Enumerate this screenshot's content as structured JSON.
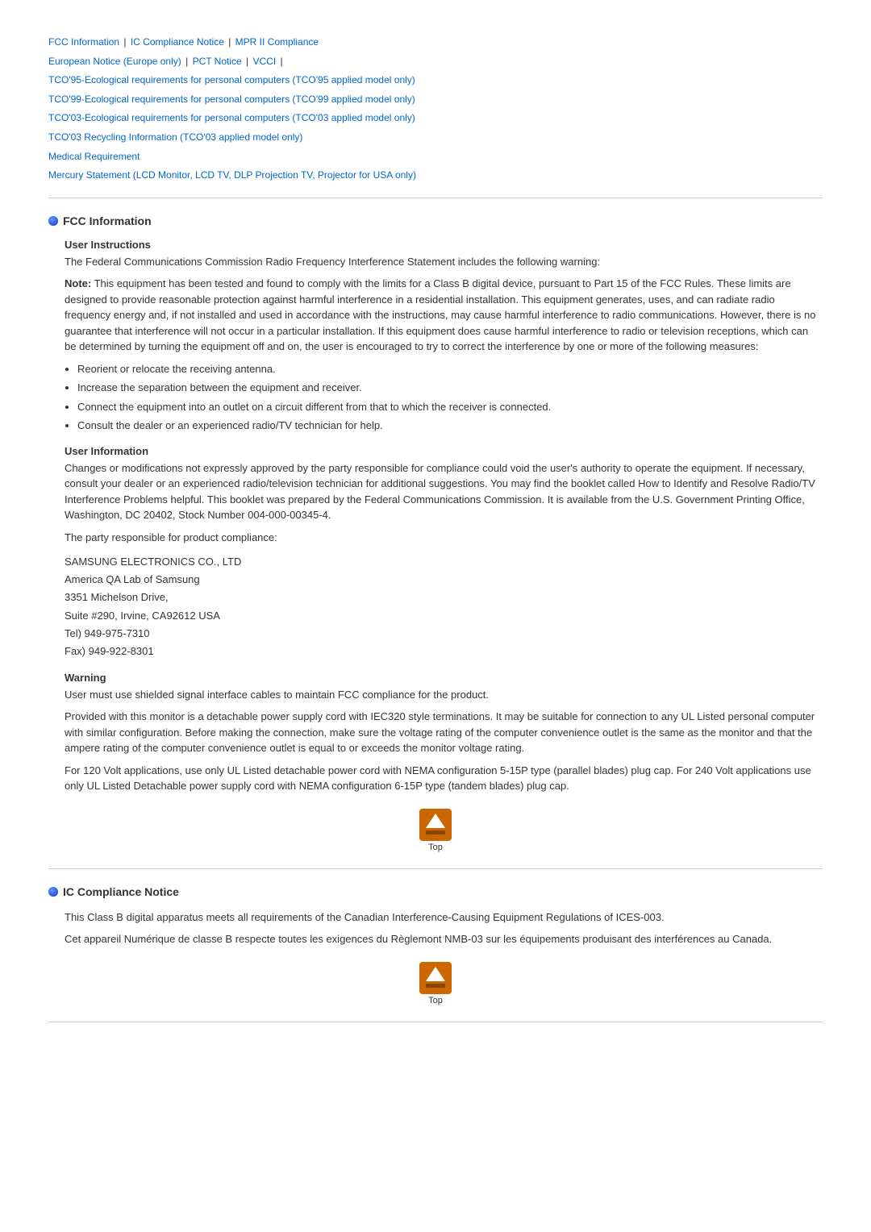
{
  "nav": {
    "links": [
      {
        "label": "FCC Information",
        "id": "fcc"
      },
      {
        "label": "IC Compliance Notice",
        "id": "ic"
      },
      {
        "label": "MPR II Compliance",
        "id": "mpr"
      },
      {
        "label": "European Notice (Europe only)",
        "id": "eu"
      },
      {
        "label": "PCT Notice",
        "id": "pct"
      },
      {
        "label": "VCCI",
        "id": "vcci"
      },
      {
        "label": "TCO'95-Ecological requirements for personal computers (TCO'95 applied model only)",
        "id": "tco95"
      },
      {
        "label": "TCO'99-Ecological requirements for personal computers (TCO'99 applied model only)",
        "id": "tco99"
      },
      {
        "label": "TCO'03-Ecological requirements for personal computers (TCO'03 applied model only)",
        "id": "tco03"
      },
      {
        "label": "TCO'03 Recycling Information (TCO'03 applied model only)",
        "id": "tco03r"
      },
      {
        "label": "Medical Requirement",
        "id": "medical"
      },
      {
        "label": "Mercury Statement (LCD Monitor, LCD TV, DLP Projection TV, Projector for USA only)",
        "id": "mercury"
      }
    ]
  },
  "sections": {
    "fcc": {
      "title": "FCC Information",
      "user_instructions_title": "User Instructions",
      "user_instructions_intro": "The Federal Communications Commission Radio Frequency Interference Statement includes the following warning:",
      "note_bold": "Note:",
      "note_text": " This equipment has been tested and found to comply with the limits for a Class B digital device, pursuant to Part 15 of the FCC Rules. These limits are designed to provide reasonable protection against harmful interference in a residential installation. This equipment generates, uses, and can radiate radio frequency energy and, if not installed and used in accordance with the instructions, may cause harmful interference to radio communications. However, there is no guarantee that interference will not occur in a particular installation. If this equipment does cause harmful interference to radio or television receptions, which can be determined by turning the equipment off and on, the user is encouraged to try to correct the interference by one or more of the following measures:",
      "measures": [
        "Reorient or relocate the receiving antenna.",
        "Increase the separation between the equipment and receiver.",
        "Connect the equipment into an outlet on a circuit different from that to which the receiver is connected.",
        "Consult the dealer or an experienced radio/TV technician for help."
      ],
      "user_information_title": "User Information",
      "user_information_text": "Changes or modifications not expressly approved by the party responsible for compliance could void the user's authority to operate the equipment. If necessary, consult your dealer or an experienced radio/television technician for additional suggestions. You may find the booklet called How to Identify and Resolve Radio/TV Interference Problems helpful. This booklet was prepared by the Federal Communications Commission. It is available from the U.S. Government Printing Office, Washington, DC 20402, Stock Number 004-000-00345-4.",
      "party_text": "The party responsible for product compliance:",
      "company_name": "SAMSUNG ELECTRONICS CO., LTD",
      "address_line1": "America QA Lab of Samsung",
      "address_line2": "3351 Michelson Drive,",
      "address_line3": "Suite #290, Irvine, CA92612 USA",
      "tel": "Tel) 949-975-7310",
      "fax": "Fax) 949-922-8301",
      "warning_title": "Warning",
      "warning_text": "User must use shielded signal interface cables to maintain FCC compliance for the product.",
      "power_cord_text": "Provided with this monitor is a detachable power supply cord with IEC320 style terminations. It may be suitable for connection to any UL Listed personal computer with similar configuration. Before making the connection, make sure the voltage rating of the computer convenience outlet is the same as the monitor and that the ampere rating of the computer convenience outlet is equal to or exceeds the monitor voltage rating.",
      "volt_text": "For 120 Volt applications, use only UL Listed detachable power cord with NEMA configuration 5-15P type (parallel blades) plug cap. For 240 Volt applications use only UL Listed Detachable power supply cord with NEMA configuration 6-15P type (tandem blades) plug cap."
    },
    "ic": {
      "title": "IC Compliance Notice",
      "text1": "This Class B digital apparatus meets all requirements of the Canadian Interference-Causing Equipment Regulations of ICES-003.",
      "text2": "Cet appareil Numérique de classe B respecte toutes les exigences du Règlemont NMB-03 sur les équipements produisant des interférences au Canada."
    }
  },
  "top_button_label": "Top"
}
